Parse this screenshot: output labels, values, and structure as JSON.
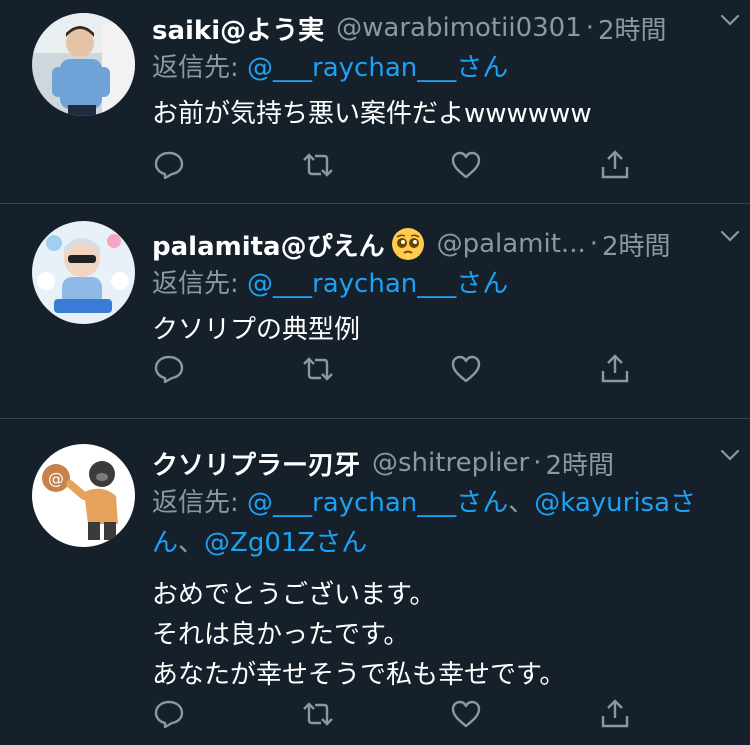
{
  "tweets": [
    {
      "name": "saiki@よう実",
      "handle": "@warabimotii0301",
      "time": "2時間",
      "reply_prefix": "返信先: ",
      "reply_links": [
        "@___raychan___さん"
      ],
      "body": [
        "お前が気持ち悪い案件だよwwwwww"
      ],
      "avatar_icon": "person-photo-avatar"
    },
    {
      "name": "palamita@ぴえん",
      "handle": "@palamit...",
      "time": "2時間",
      "reply_prefix": "返信先: ",
      "reply_links": [
        "@___raychan___さん"
      ],
      "body": [
        "クソリプの典型例"
      ],
      "avatar_icon": "anime-sticker-avatar"
    },
    {
      "name": "クソリプラー刃牙",
      "handle": "@shitreplier",
      "time": "2時間",
      "reply_prefix": "返信先: ",
      "reply_links": [
        "@___raychan___さん",
        "@kayurisaさん",
        "@Zg01Zさん"
      ],
      "reply_separator": "、",
      "body": [
        "おめでとうございます。",
        "それは良かったです。",
        "あなたが幸せそうで私も幸せです。"
      ],
      "avatar_icon": "gorilla-throwing-at-avatar"
    }
  ],
  "colors": {
    "background": "#15202b",
    "divider": "#38444d",
    "secondary_text": "#8899a6",
    "link": "#1da1f2"
  },
  "actions": [
    "reply-icon",
    "retweet-icon",
    "like-icon",
    "share-icon"
  ]
}
